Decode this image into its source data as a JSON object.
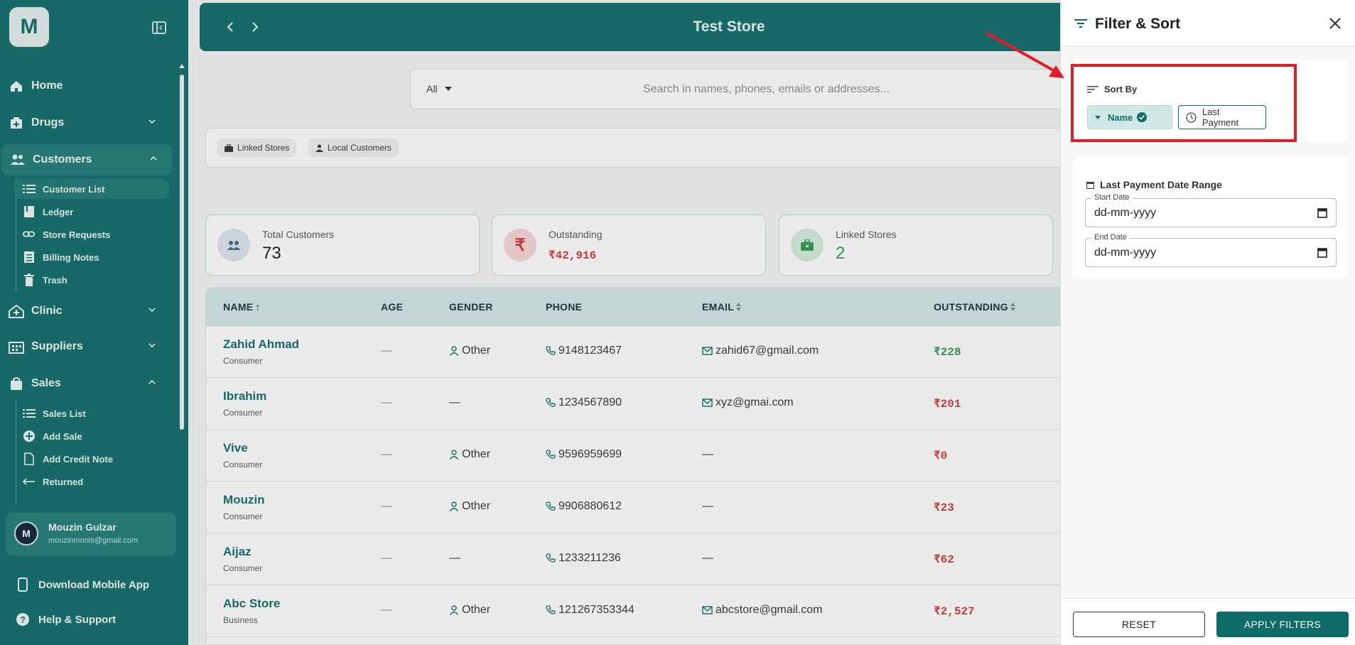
{
  "sidebar": {
    "logo_letter": "M",
    "items": [
      {
        "label": "Home"
      },
      {
        "label": "Drugs"
      },
      {
        "label": "Customers"
      },
      {
        "label": "Clinic"
      },
      {
        "label": "Suppliers"
      },
      {
        "label": "Sales"
      }
    ],
    "customers_sub": [
      {
        "label": "Customer List"
      },
      {
        "label": "Ledger"
      },
      {
        "label": "Store Requests"
      },
      {
        "label": "Billing Notes"
      },
      {
        "label": "Trash"
      }
    ],
    "sales_sub": [
      {
        "label": "Sales List"
      },
      {
        "label": "Add Sale"
      },
      {
        "label": "Add Credit Note"
      },
      {
        "label": "Returned"
      }
    ],
    "user": {
      "initial": "M",
      "name": "Mouzin Gulzar",
      "email": "mouzinmonis@gmail.com"
    },
    "download_app": "Download Mobile App",
    "help": "Help & Support"
  },
  "header": {
    "title": "Test Store"
  },
  "search": {
    "filter_value": "All",
    "placeholder": "Search in names, phones, emails or addresses..."
  },
  "tabs": [
    {
      "label": "Linked Stores"
    },
    {
      "label": "Local Customers"
    }
  ],
  "stats": [
    {
      "label": "Total Customers",
      "value": "73"
    },
    {
      "label": "Outstanding",
      "value": "₹42,916"
    },
    {
      "label": "Linked Stores",
      "value": "2"
    }
  ],
  "table": {
    "headers": [
      "NAME",
      "AGE",
      "GENDER",
      "PHONE",
      "EMAIL",
      "OUTSTANDING"
    ],
    "rows": [
      {
        "name": "Zahid Ahmad",
        "type": "Consumer",
        "age": "—",
        "gender": "Other",
        "phone": "9148123467",
        "email": "zahid67@gmail.com",
        "outstanding": "₹228"
      },
      {
        "name": "Ibrahim",
        "type": "Consumer",
        "age": "—",
        "gender": "—",
        "phone": "1234567890",
        "email": "xyz@gmai.com",
        "outstanding": "₹201"
      },
      {
        "name": "Vive",
        "type": "Consumer",
        "age": "—",
        "gender": "Other",
        "phone": "9596959699",
        "email": "—",
        "outstanding": "₹0"
      },
      {
        "name": "Mouzin",
        "type": "Consumer",
        "age": "—",
        "gender": "Other",
        "phone": "9906880612",
        "email": "—",
        "outstanding": "₹23"
      },
      {
        "name": "Aijaz",
        "type": "Consumer",
        "age": "—",
        "gender": "—",
        "phone": "1233211236",
        "email": "—",
        "outstanding": "₹62"
      },
      {
        "name": "Abc Store",
        "type": "Business",
        "age": "—",
        "gender": "Other",
        "phone": "121267353344",
        "email": "abcstore@gmail.com",
        "outstanding": "₹2,527"
      }
    ]
  },
  "drawer": {
    "title": "Filter & Sort",
    "sort_by": "Sort By",
    "sort_name": "Name",
    "sort_last_payment": "Last Payment",
    "date_range_title": "Last Payment Date Range",
    "start_label": "Start Date",
    "start_value": "dd-mm-yyyy",
    "end_label": "End Date",
    "end_value": "dd-mm-yyyy",
    "reset": "RESET",
    "apply": "APPLY FILTERS"
  },
  "colors": {
    "brand": "#0d6b68",
    "positive": "#2e9a4b",
    "negative": "#d93636",
    "highlight": "#e31d25"
  }
}
